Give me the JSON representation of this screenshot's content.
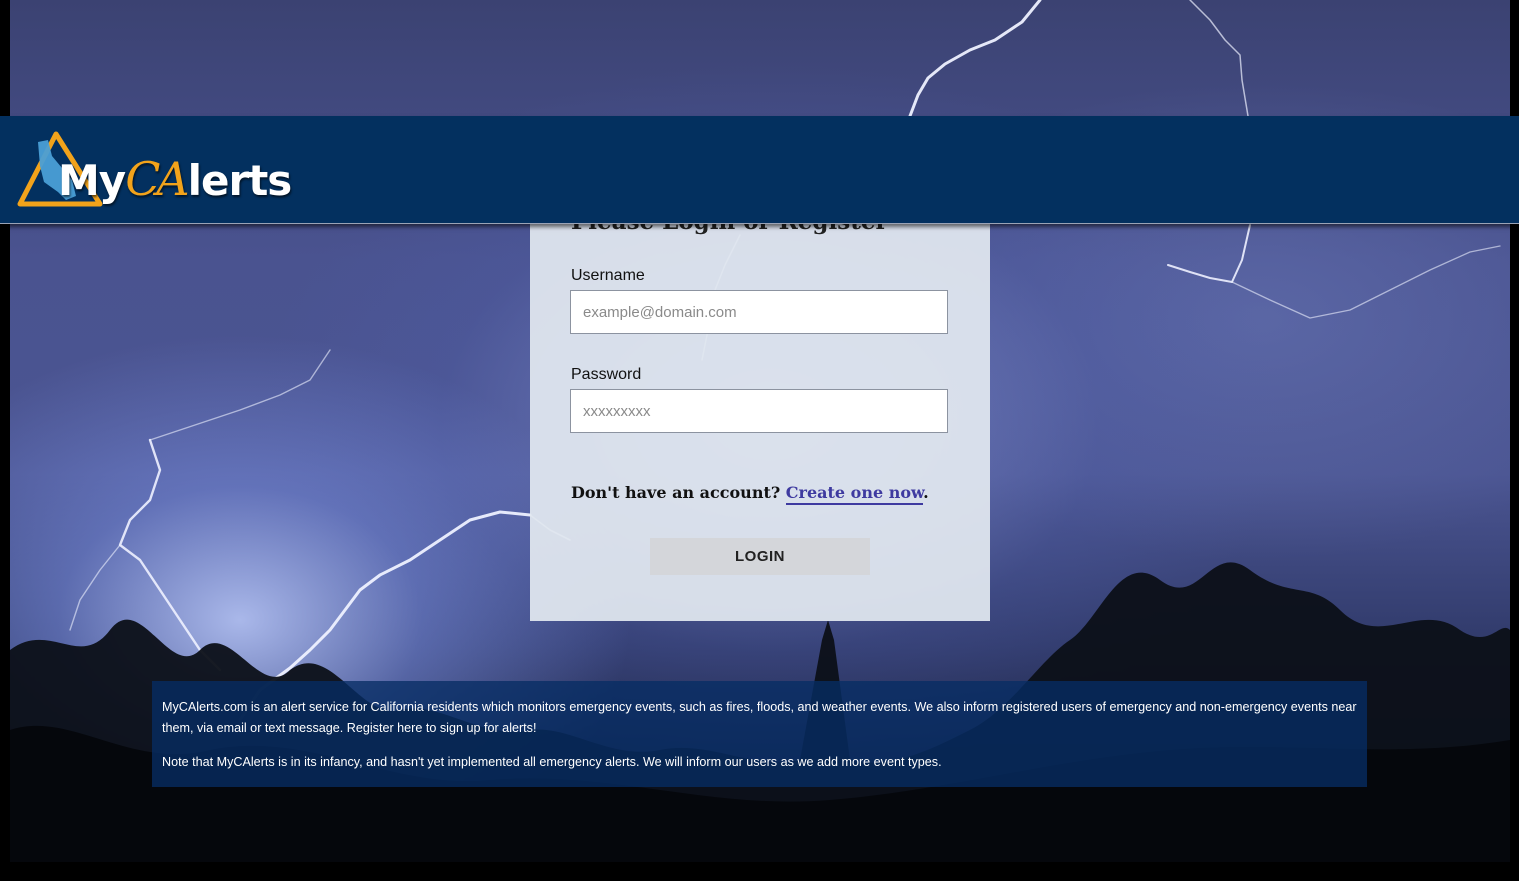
{
  "header": {
    "logo": {
      "prefix": "My",
      "ca": "CA",
      "suffix": "lerts",
      "icon": "california-triangle-icon"
    }
  },
  "login": {
    "title": "Please Login or Register",
    "username_label": "Username",
    "username_placeholder": "example@domain.com",
    "password_label": "Password",
    "password_placeholder": "xxxxxxxxx",
    "account_prompt": "Don't have an account?",
    "create_link": "Create one now",
    "create_suffix": ".",
    "login_button": "LOGIN"
  },
  "info": {
    "paragraph1": "MyCAlerts.com is an alert service for California residents which monitors emergency events, such as fires, floods, and weather events. We also inform registered users of emergency and non-emergency events near them, via email or text message. Register here to sign up for alerts!",
    "paragraph2": "Note that MyCAlerts is in its infancy, and hasn't yet implemented all emergency alerts. We will inform our users as we add more event types."
  },
  "colors": {
    "header_bg": "#03305f",
    "logo_accent": "#f2a31b",
    "link": "#3e3aa0",
    "button_bg": "#d4d6da"
  }
}
